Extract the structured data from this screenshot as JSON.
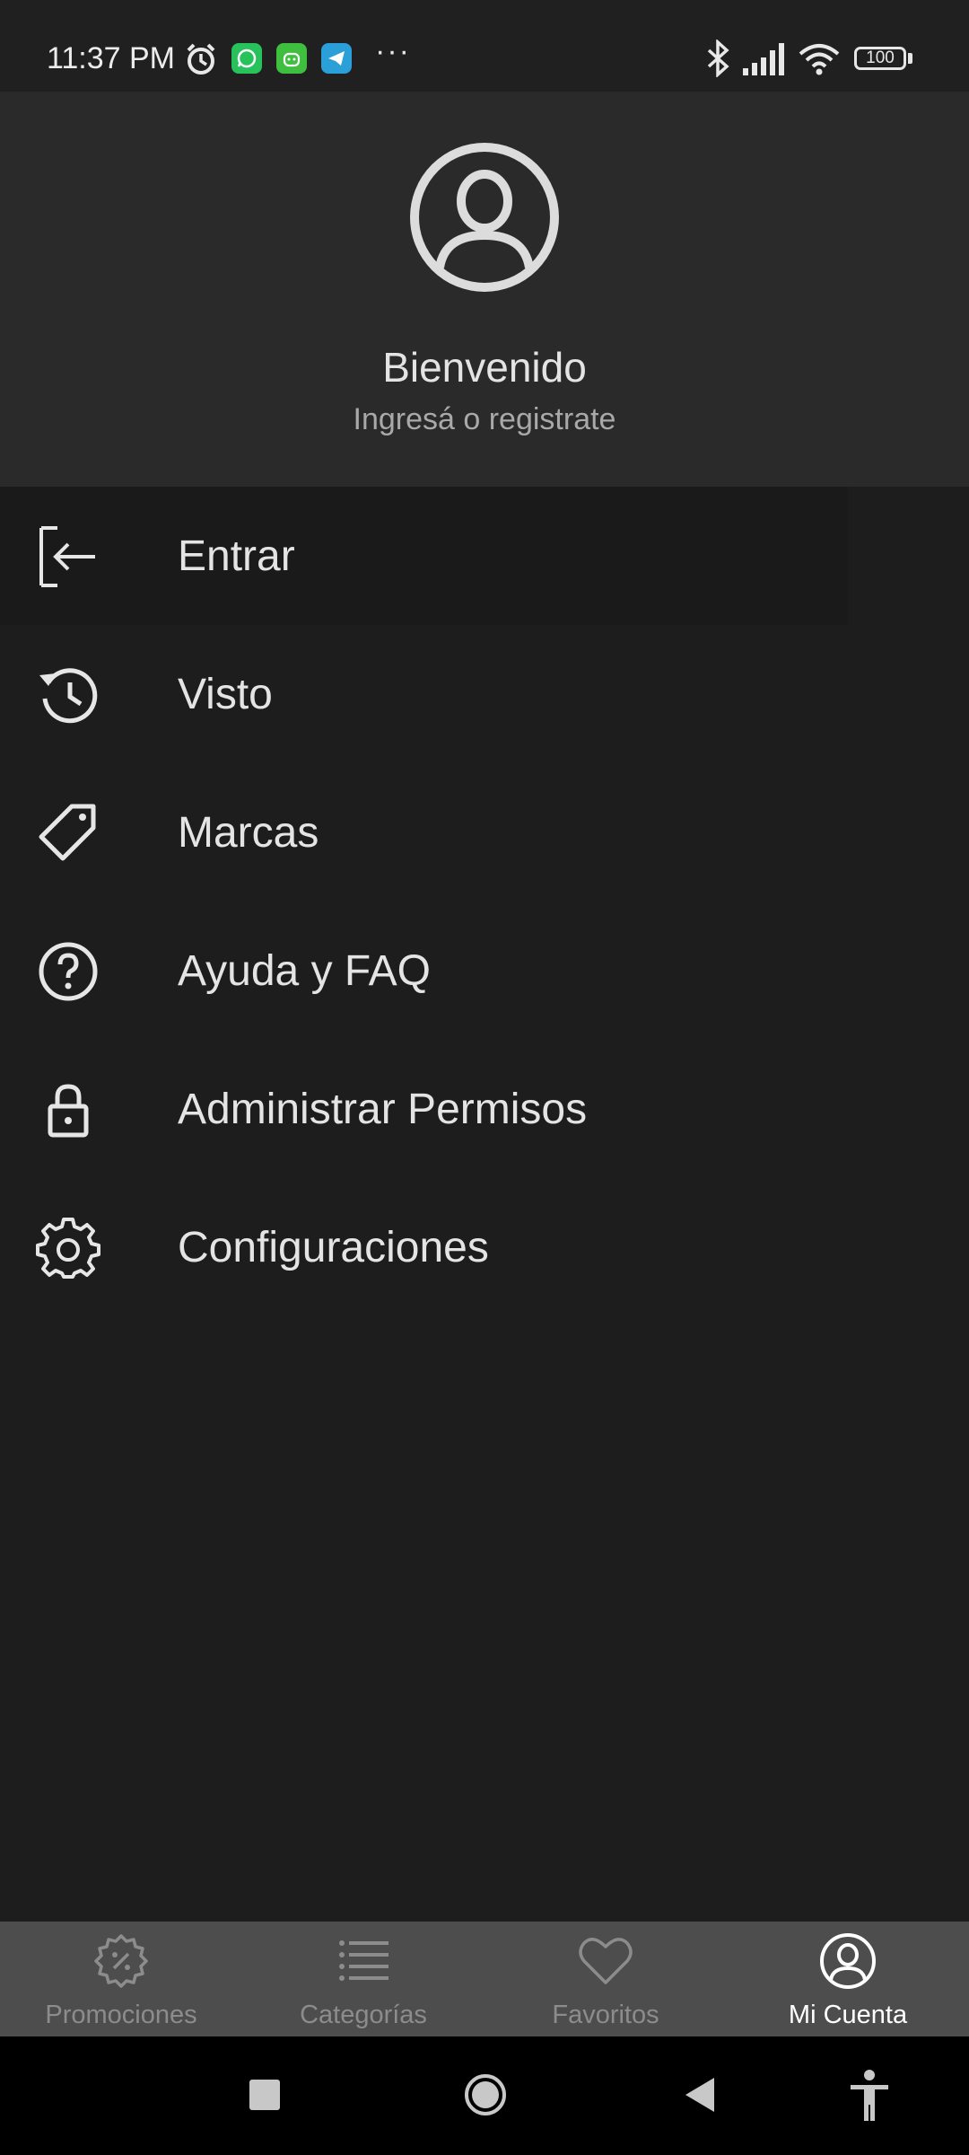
{
  "status_bar": {
    "time": "11:37 PM",
    "battery": "100",
    "icons": [
      "alarm-icon",
      "whatsapp-icon",
      "android-app-icon",
      "telegram-icon",
      "more-dots",
      "bluetooth-icon",
      "signal-icon",
      "wifi-icon",
      "battery-icon"
    ],
    "dots": "···"
  },
  "header": {
    "title": "Bienvenido",
    "subtitle": "Ingresá o registrate"
  },
  "menu": {
    "items": [
      {
        "label": "Entrar",
        "icon": "login-icon"
      },
      {
        "label": "Visto",
        "icon": "history-icon"
      },
      {
        "label": "Marcas",
        "icon": "tag-icon"
      },
      {
        "label": "Ayuda y FAQ",
        "icon": "help-icon"
      },
      {
        "label": "Administrar Permisos",
        "icon": "lock-icon"
      },
      {
        "label": "Configuraciones",
        "icon": "gear-icon"
      }
    ]
  },
  "bottom_nav": {
    "items": [
      {
        "label": "Promociones",
        "icon": "promo-badge-icon"
      },
      {
        "label": "Categorías",
        "icon": "list-icon"
      },
      {
        "label": "Favoritos",
        "icon": "heart-icon"
      },
      {
        "label": "Mi Cuenta",
        "icon": "account-icon",
        "active": true
      }
    ]
  },
  "colors": {
    "background": "#1d1d1d",
    "header": "#2a2a2a",
    "bottom_nav": "#4d4d4d",
    "text": "#e4e4e4",
    "muted": "#a9a9a9"
  }
}
